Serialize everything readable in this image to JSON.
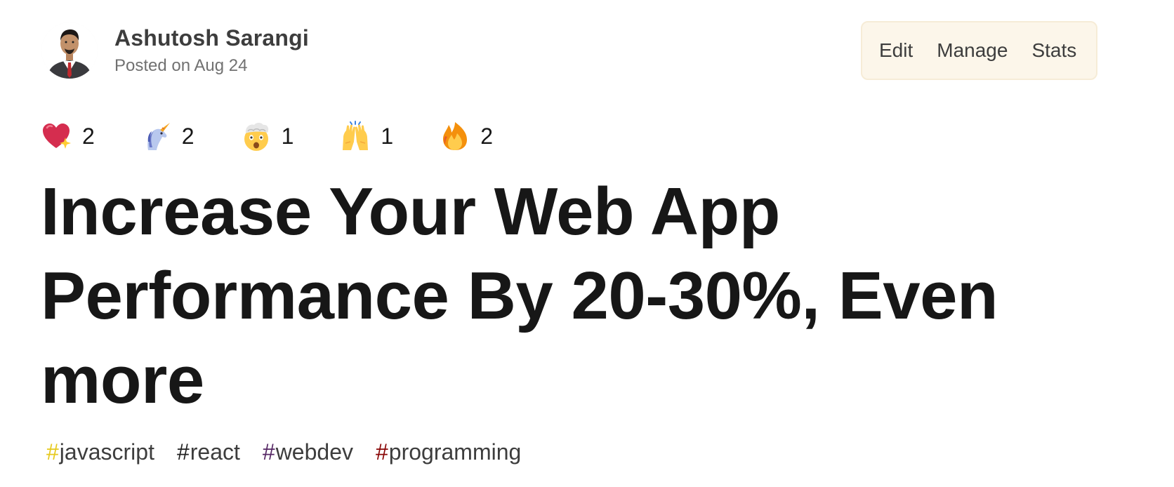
{
  "author": {
    "name": "Ashutosh Sarangi",
    "posted": "Posted on Aug 24"
  },
  "actions": {
    "edit": "Edit",
    "manage": "Manage",
    "stats": "Stats"
  },
  "reactions": [
    {
      "icon": "sparkle-heart-icon",
      "count": "2"
    },
    {
      "icon": "unicorn-icon",
      "count": "2"
    },
    {
      "icon": "exploding-head-icon",
      "count": "1"
    },
    {
      "icon": "raised-hands-icon",
      "count": "1"
    },
    {
      "icon": "fire-icon",
      "count": "2"
    }
  ],
  "title": "Increase Your Web App Performance By 20-30%, Even more",
  "tags": [
    {
      "hash": "#",
      "label": "javascript",
      "color": "#e6c91d"
    },
    {
      "hash": "#",
      "label": "react",
      "color": "#222222"
    },
    {
      "hash": "#",
      "label": "webdev",
      "color": "#562765"
    },
    {
      "hash": "#",
      "label": "programming",
      "color": "#890606"
    }
  ]
}
